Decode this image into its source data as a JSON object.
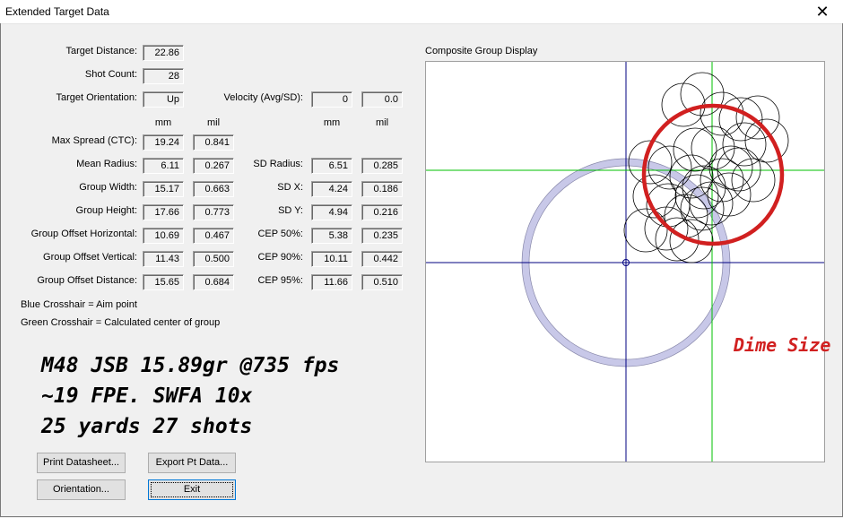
{
  "window": {
    "title": "Extended Target Data",
    "close_glyph": "✕"
  },
  "left": {
    "target_distance_label": "Target Distance:",
    "target_distance": "22.86",
    "shot_count_label": "Shot Count:",
    "shot_count": "28",
    "target_orientation_label": "Target Orientation:",
    "target_orientation": "Up",
    "velocity_label": "Velocity (Avg/SD):",
    "velocity_avg": "0",
    "velocity_sd": "0.0",
    "col_mm": "mm",
    "col_mil": "mil",
    "rows": [
      {
        "label": "Max Spread (CTC):",
        "mm": "19.24",
        "mil": "0.841"
      },
      {
        "label": "Mean Radius:",
        "mm": "6.11",
        "mil": "0.267"
      },
      {
        "label": "Group Width:",
        "mm": "15.17",
        "mil": "0.663"
      },
      {
        "label": "Group Height:",
        "mm": "17.66",
        "mil": "0.773"
      },
      {
        "label": "Group Offset Horizontal:",
        "mm": "10.69",
        "mil": "0.467"
      },
      {
        "label": "Group Offset Vertical:",
        "mm": "11.43",
        "mil": "0.500"
      },
      {
        "label": "Group Offset Distance:",
        "mm": "15.65",
        "mil": "0.684"
      }
    ],
    "right_rows": [
      {
        "label": "SD Radius:",
        "mm": "6.51",
        "mil": "0.285"
      },
      {
        "label": "SD X:",
        "mm": "4.24",
        "mil": "0.186"
      },
      {
        "label": "SD Y:",
        "mm": "4.94",
        "mil": "0.216"
      },
      {
        "label": "CEP 50%:",
        "mm": "5.38",
        "mil": "0.235"
      },
      {
        "label": "CEP 90%:",
        "mm": "10.11",
        "mil": "0.442"
      },
      {
        "label": "CEP 95%:",
        "mm": "11.66",
        "mil": "0.510"
      }
    ],
    "legend_blue": "Blue Crosshair = Aim point",
    "legend_green": "Green Crosshair = Calculated center of group",
    "note_line1": "M48 JSB 15.89gr @735 fps",
    "note_line2": "~19 FPE.  SWFA 10x",
    "note_line3": "25 yards  27 shots"
  },
  "buttons": {
    "print_datasheet": "Print Datasheet...",
    "export_pt_data": "Export Pt Data...",
    "orientation": "Orientation...",
    "exit": "Exit"
  },
  "plot": {
    "title": "Composite Group Display",
    "annotation": "Dime Size",
    "colors": {
      "aim": "#000080",
      "center": "#00c000",
      "annotation": "#d12020",
      "ring": "#c8c8e8"
    }
  }
}
